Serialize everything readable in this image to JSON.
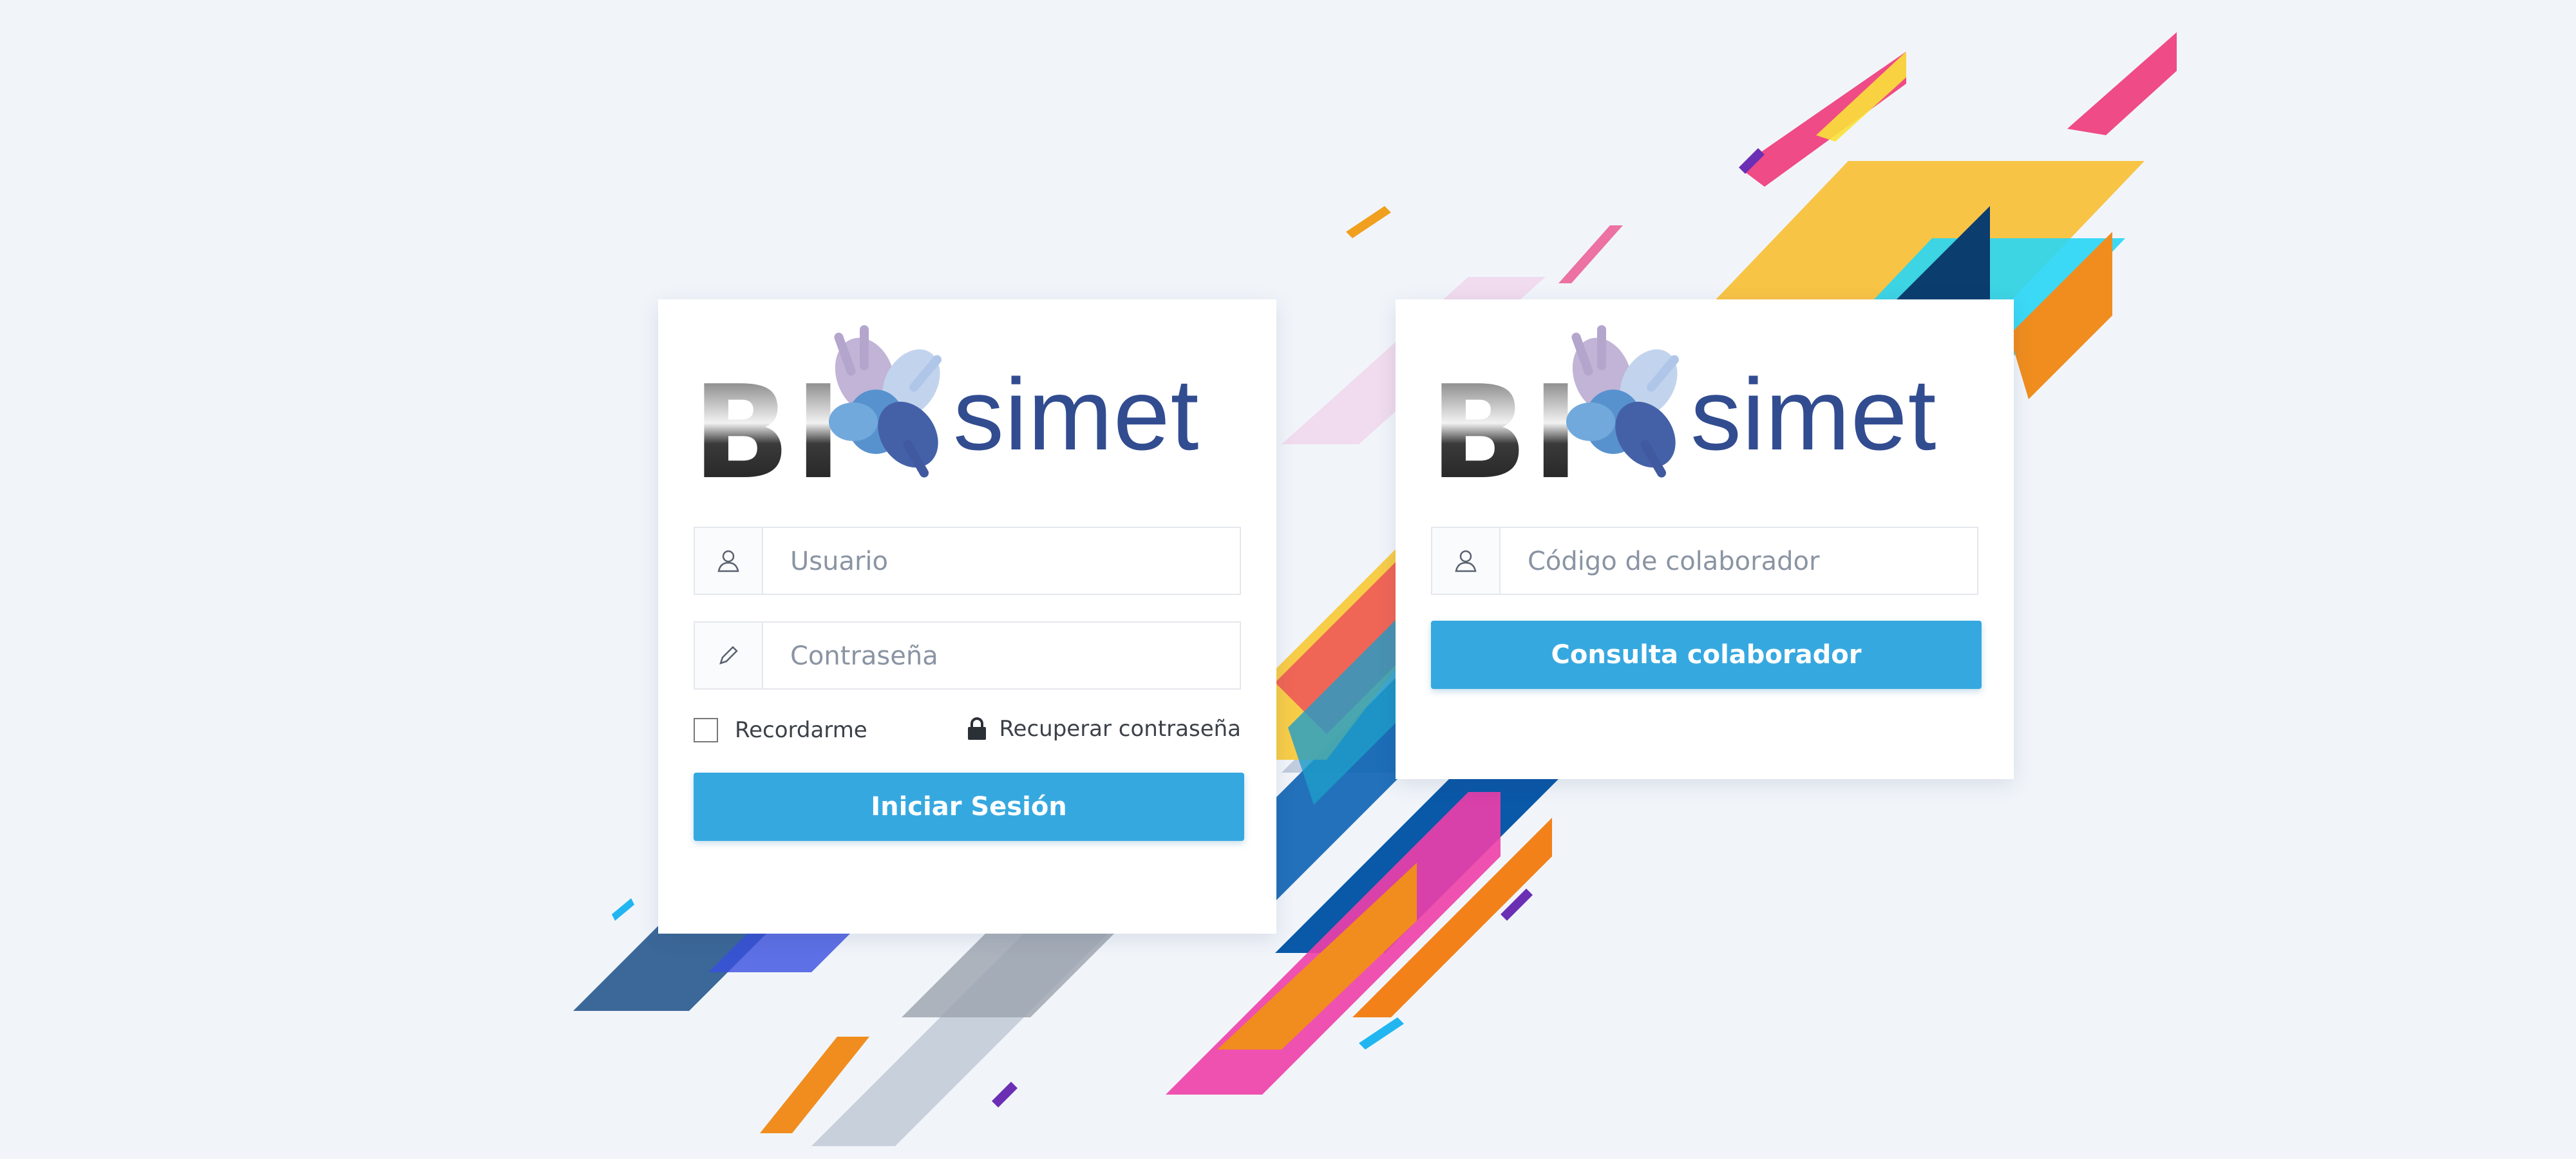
{
  "colors": {
    "background": "#f1f5fa",
    "card": "#ffffff",
    "button": "#36a8e0",
    "logo_blue": "#324c90"
  },
  "login_card": {
    "logo": {
      "part1": "BI",
      "part2": "simet"
    },
    "username": {
      "placeholder": "Usuario",
      "icon": "user-icon"
    },
    "password": {
      "placeholder": "Contraseña",
      "icon": "pencil-icon"
    },
    "remember_label": "Recordarme",
    "recover_label": "Recuperar contraseña",
    "recover_icon": "lock-icon",
    "submit_label": "Iniciar Sesión"
  },
  "collab_card": {
    "logo": {
      "part1": "BI",
      "part2": "simet"
    },
    "code": {
      "placeholder": "Código de colaborador",
      "icon": "user-icon"
    },
    "submit_label": "Consulta colaborador"
  }
}
